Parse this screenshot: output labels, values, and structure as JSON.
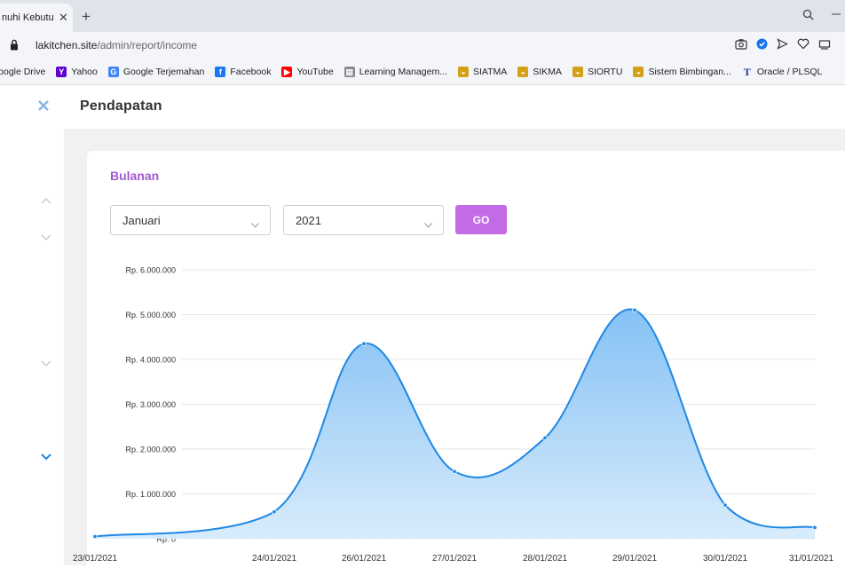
{
  "browser": {
    "tab_title": "nuhi Kebutu",
    "tab_close": "✕",
    "new_tab": "+",
    "url_domain": "lakitchen.site",
    "url_path": "/admin/report/income",
    "bookmarks": [
      {
        "label": "Google Drive",
        "icon": "drive-icon",
        "color": "#34a853"
      },
      {
        "label": "Yahoo",
        "icon": "yahoo-icon",
        "color": "#6001d2"
      },
      {
        "label": "Google Terjemahan",
        "icon": "translate-icon",
        "color": "#4285f4"
      },
      {
        "label": "Facebook",
        "icon": "facebook-icon",
        "color": "#1877f2"
      },
      {
        "label": "YouTube",
        "icon": "youtube-icon",
        "color": "#ff0000"
      },
      {
        "label": "Learning Managem...",
        "icon": "lms-icon",
        "color": "#888888"
      },
      {
        "label": "SIATMA",
        "icon": "siatma-icon",
        "color": "#d4a017"
      },
      {
        "label": "SIKMA",
        "icon": "sikma-icon",
        "color": "#d4a017"
      },
      {
        "label": "SIORTU",
        "icon": "siortu-icon",
        "color": "#d4a017"
      },
      {
        "label": "Sistem Bimbingan...",
        "icon": "bimbingan-icon",
        "color": "#d4a017"
      },
      {
        "label": "Oracle / PLSQL",
        "icon": "oracle-icon",
        "color": "#1f3a93"
      }
    ]
  },
  "page": {
    "title": "Pendapatan",
    "card_title": "Bulanan",
    "month_select": "Januari",
    "year_select": "2021",
    "go_label": "GO"
  },
  "colors": {
    "accent": "#c36ae7",
    "heading": "#a05ad0",
    "line": "#1e88e5",
    "area": "#90caf9"
  },
  "chart_data": {
    "type": "area",
    "x": [
      "23/01/2021",
      "24/01/2021",
      "26/01/2021",
      "27/01/2021",
      "28/01/2021",
      "29/01/2021",
      "30/01/2021",
      "31/01/2021"
    ],
    "values": [
      50000,
      600000,
      4350000,
      1500000,
      2250000,
      5100000,
      750000,
      250000
    ],
    "y_ticks": [
      "Rp. 0",
      "Rp. 1.000.000",
      "Rp. 2.000.000",
      "Rp. 3.000.000",
      "Rp. 4.000.000",
      "Rp. 5.000.000",
      "Rp. 6.000.000"
    ],
    "ylim": [
      0,
      6000000
    ],
    "grid": true,
    "curve": "smooth"
  }
}
